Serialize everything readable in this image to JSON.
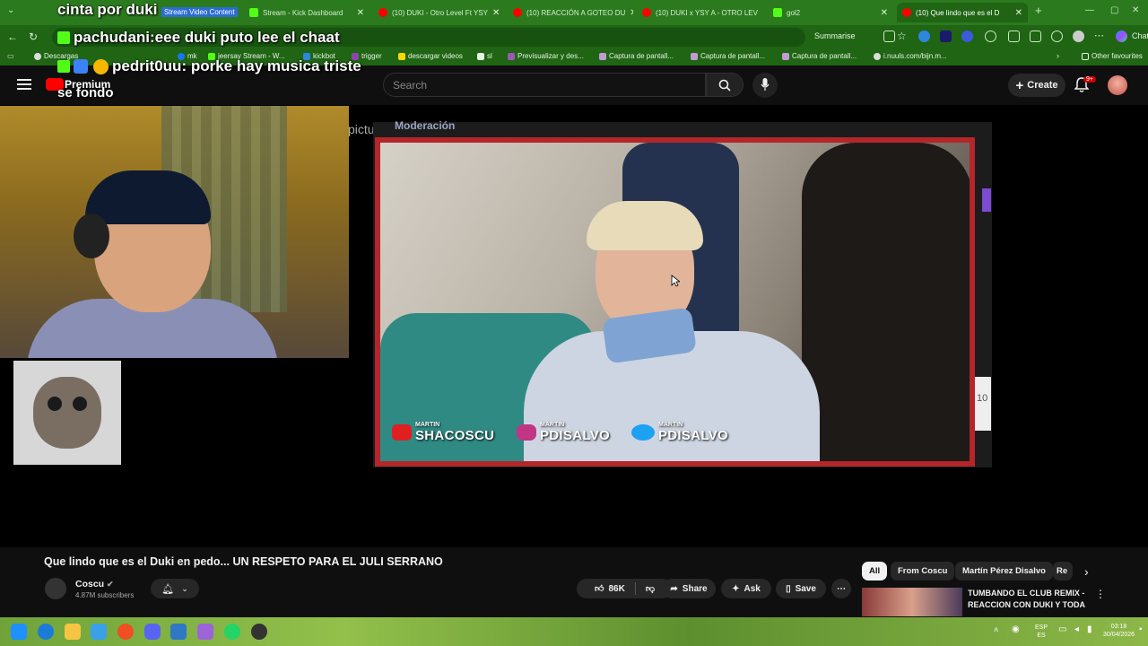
{
  "overlay_chat": {
    "line1": "cinta por duki",
    "line2_user": "pachudani:",
    "line2_msg": "eee duki puto lee el chaat",
    "line3_user": "pedrit0uu:",
    "line3_msg": "porke hay musica triste",
    "line4": "se fondo",
    "badge": "Stream Video Content"
  },
  "browser": {
    "tabs": [
      {
        "label": "Stream - Kick Dashboard",
        "color": "#53fc18"
      },
      {
        "label": "(10) DUKI - Otro Level Ft YSY",
        "color": "#ff0000"
      },
      {
        "label": "(10) REACCIÓN A GOTEO DU",
        "color": "#ff0000"
      },
      {
        "label": "(10) DUKI x YSY A - OTRO LEV",
        "color": "#ff0000"
      },
      {
        "label": "gol2",
        "color": "#53fc18"
      },
      {
        "label": "(10) Que lindo que es el D",
        "color": "#ff0000"
      }
    ],
    "summarise_label": "Summarise",
    "chat_label": "Chat",
    "bookmarks": [
      "Descargas",
      "mk",
      "jeersay Stream - W...",
      "kickbot",
      "trigger",
      "descargar videos",
      "sl",
      "Previsualizar y des...",
      "Captura de pantall...",
      "Captura de pantall...",
      "Captura de pantall...",
      "i.nuuls.com/bijn.m..."
    ],
    "other_favourites": "Other favourites"
  },
  "youtube": {
    "logo_text": "Premium",
    "search_placeholder": "Search",
    "create_label": "Create",
    "notif_count": "9+"
  },
  "player": {
    "pictu_text": "pictu",
    "moderacion_text": "Moderación",
    "side_number": "10",
    "socials": [
      {
        "small": "MARTIN",
        "big": "SHACOSCU",
        "icon_color": "#e02020"
      },
      {
        "small": "MARTIN",
        "big": "PDISALVO",
        "icon_color": "#c13584"
      },
      {
        "small": "MARTIN",
        "big": "PDISALVO",
        "icon_color": "#1da1f2"
      }
    ]
  },
  "video": {
    "title": "Que lindo que es el Duki en pedo... UN RESPETO PARA EL JULI SERRANO",
    "channel": "Coscu",
    "subscribers": "4.87M subscribers",
    "likes": "86K",
    "share_label": "Share",
    "ask_label": "Ask",
    "save_label": "Save"
  },
  "recommendations": {
    "chips": [
      "All",
      "From Coscu",
      "Martín Pérez Disalvo",
      "Re"
    ],
    "first_title": "TUMBANDO EL CLUB REMIX - REACCION CON DUKI Y TODA ..."
  },
  "taskbar": {
    "lang_top": "ESP",
    "lang_bottom": "ES",
    "time": "03:18",
    "date": "30/04/2026"
  }
}
